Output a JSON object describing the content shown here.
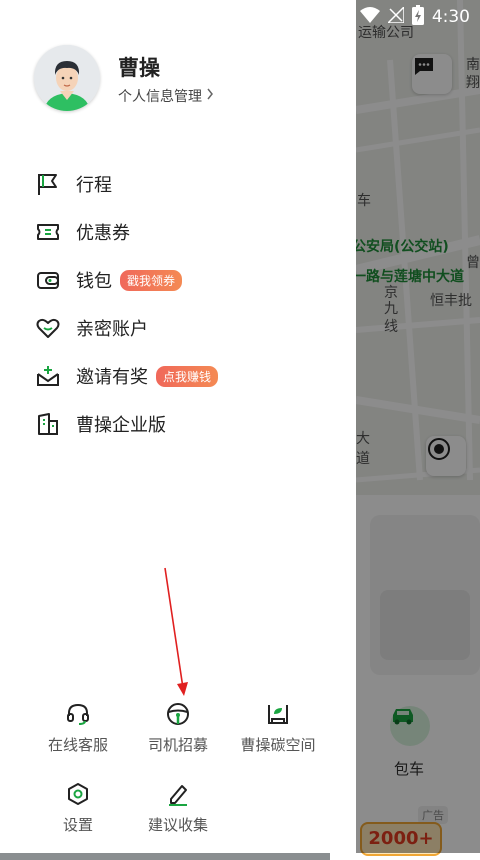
{
  "status_bar": {
    "time": "4:30"
  },
  "map": {
    "labels": {
      "top_company": "运输公司",
      "side_right_top": "南",
      "side_right_top2": "翔",
      "car_suffix": "车",
      "police": "公安局(公交站)",
      "road": "一路与莲塘中大道",
      "jing": "京",
      "jiu": "九",
      "xian": "线",
      "hengfeng": "恒丰批",
      "zeng": "曾",
      "da": "大",
      "dao": "道"
    },
    "service_label": "包车",
    "ad_tag": "广告",
    "promo_amount": "2000+"
  },
  "user": {
    "name": "曹操",
    "profile_link": "个人信息管理"
  },
  "menu": [
    {
      "label": "行程",
      "icon": "flag-icon"
    },
    {
      "label": "优惠券",
      "icon": "coupon-icon"
    },
    {
      "label": "钱包",
      "icon": "wallet-icon",
      "badge": "戳我领券"
    },
    {
      "label": "亲密账户",
      "icon": "heart-icon"
    },
    {
      "label": "邀请有奖",
      "icon": "invite-icon",
      "badge": "点我赚钱"
    },
    {
      "label": "曹操企业版",
      "icon": "building-icon"
    }
  ],
  "tools": [
    {
      "label": "在线客服",
      "icon": "headset-icon"
    },
    {
      "label": "司机招募",
      "icon": "steering-wheel-icon"
    },
    {
      "label": "曹操碳空间",
      "icon": "leaf-box-icon"
    },
    {
      "label": "设置",
      "icon": "settings-icon"
    },
    {
      "label": "建议收集",
      "icon": "pen-icon"
    }
  ],
  "colors": {
    "accent_green": "#1aa541",
    "badge_gradient_start": "#f0685a",
    "badge_gradient_end": "#f48a54",
    "annotation_arrow": "#e02020"
  }
}
